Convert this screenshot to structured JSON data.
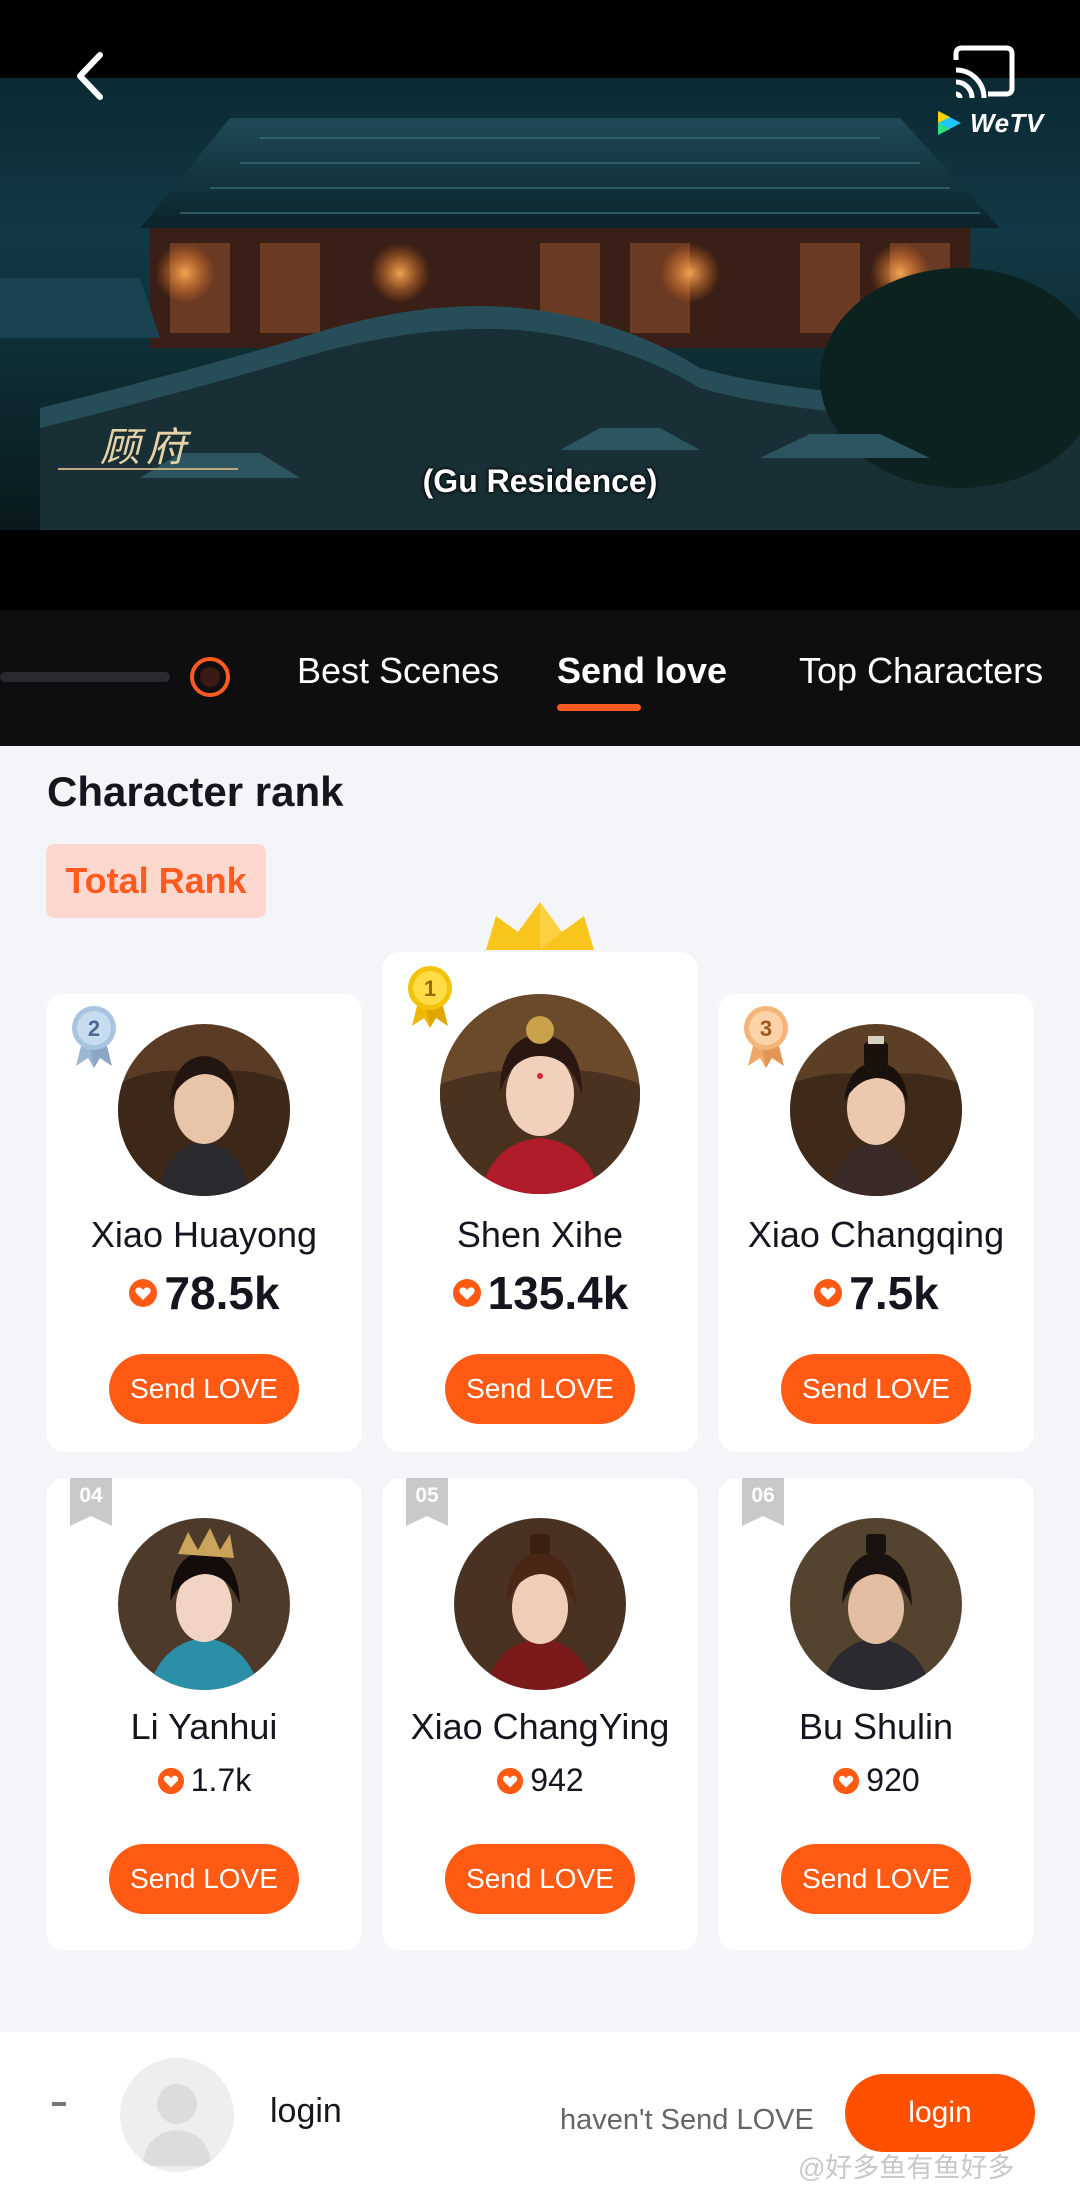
{
  "player": {
    "subtitle": "(Gu Residence)",
    "place_caption": "顾府",
    "brand": "WeTV"
  },
  "tabs": [
    {
      "label": "Best Scenes"
    },
    {
      "label": "Send love"
    },
    {
      "label": "Top Characters"
    }
  ],
  "section": {
    "title": "Character rank",
    "filter_label": "Total Rank"
  },
  "characters": [
    {
      "rank": "1",
      "name": "Shen Xihe",
      "love": "135.4k",
      "button": "Send LOVE"
    },
    {
      "rank": "2",
      "name": "Xiao Huayong",
      "love": "78.5k",
      "button": "Send LOVE"
    },
    {
      "rank": "3",
      "name": "Xiao Changqing",
      "love": "7.5k",
      "button": "Send LOVE"
    },
    {
      "rank": "04",
      "name": "Li Yanhui",
      "love": "1.7k",
      "button": "Send LOVE"
    },
    {
      "rank": "05",
      "name": "Xiao ChangYing",
      "love": "942",
      "button": "Send LOVE"
    },
    {
      "rank": "06",
      "name": "Bu Shulin",
      "love": "920",
      "button": "Send LOVE"
    }
  ],
  "bottom_bar": {
    "rank_placeholder": "-",
    "user_label": "login",
    "status": "haven't Send LOVE",
    "login_button": "login",
    "watermark": "@好多鱼有鱼好多"
  },
  "colors": {
    "accent": "#ff5a14",
    "chip_bg": "#fdd8cf",
    "gold": "#f5c20a",
    "silver": "#9bb7d4",
    "bronze": "#f0a868"
  }
}
